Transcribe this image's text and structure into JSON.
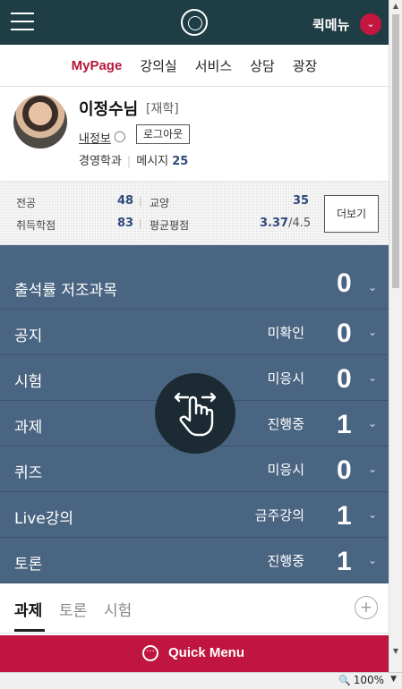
{
  "header": {
    "quick_menu_label": "퀵메뉴",
    "quick_menu_toggle_glyph": "⌄",
    "menu_icon": "hamburger-icon",
    "logo_icon": "university-seal-logo"
  },
  "nav": {
    "items": [
      "MyPage",
      "강의실",
      "서비스",
      "상담",
      "광장"
    ],
    "active": "MyPage"
  },
  "profile": {
    "name": "이정수님",
    "status": "[재학]",
    "my_info_link": "내정보",
    "logout_button": "로그아웃",
    "department": "경영학과",
    "message_label": "메시지",
    "message_count": "25"
  },
  "grades": {
    "major_label": "전공",
    "major_value": "48",
    "liberal_label": "교양",
    "liberal_value": "35",
    "credits_label": "취득학점",
    "credits_value": "83",
    "gpa_label": "평균평점",
    "gpa_value": "3.37",
    "gpa_max": "/4.5",
    "more_button": "더보기"
  },
  "stats": [
    {
      "label": "출석률 저조과목",
      "status": "",
      "count": "0"
    },
    {
      "label": "공지",
      "status": "미확인",
      "count": "0"
    },
    {
      "label": "시험",
      "status": "미응시",
      "count": "0"
    },
    {
      "label": "과제",
      "status": "진행중",
      "count": "1"
    },
    {
      "label": "퀴즈",
      "status": "미응시",
      "count": "0"
    },
    {
      "label": "Live강의",
      "status": "금주강의",
      "count": "1"
    },
    {
      "label": "토론",
      "status": "진행중",
      "count": "1"
    }
  ],
  "tabs": {
    "items": [
      "과제",
      "토론",
      "시험"
    ],
    "active": "과제",
    "add_glyph": "+"
  },
  "quick_menu_bar": {
    "label": "Quick Menu",
    "icon_glyph": "···"
  },
  "statusbar": {
    "zoom": "100%"
  },
  "colors": {
    "header_bg": "#1f3d44",
    "accent": "#c0153f",
    "stats_bg": "#4a6582",
    "value_blue": "#2f4a7a"
  }
}
